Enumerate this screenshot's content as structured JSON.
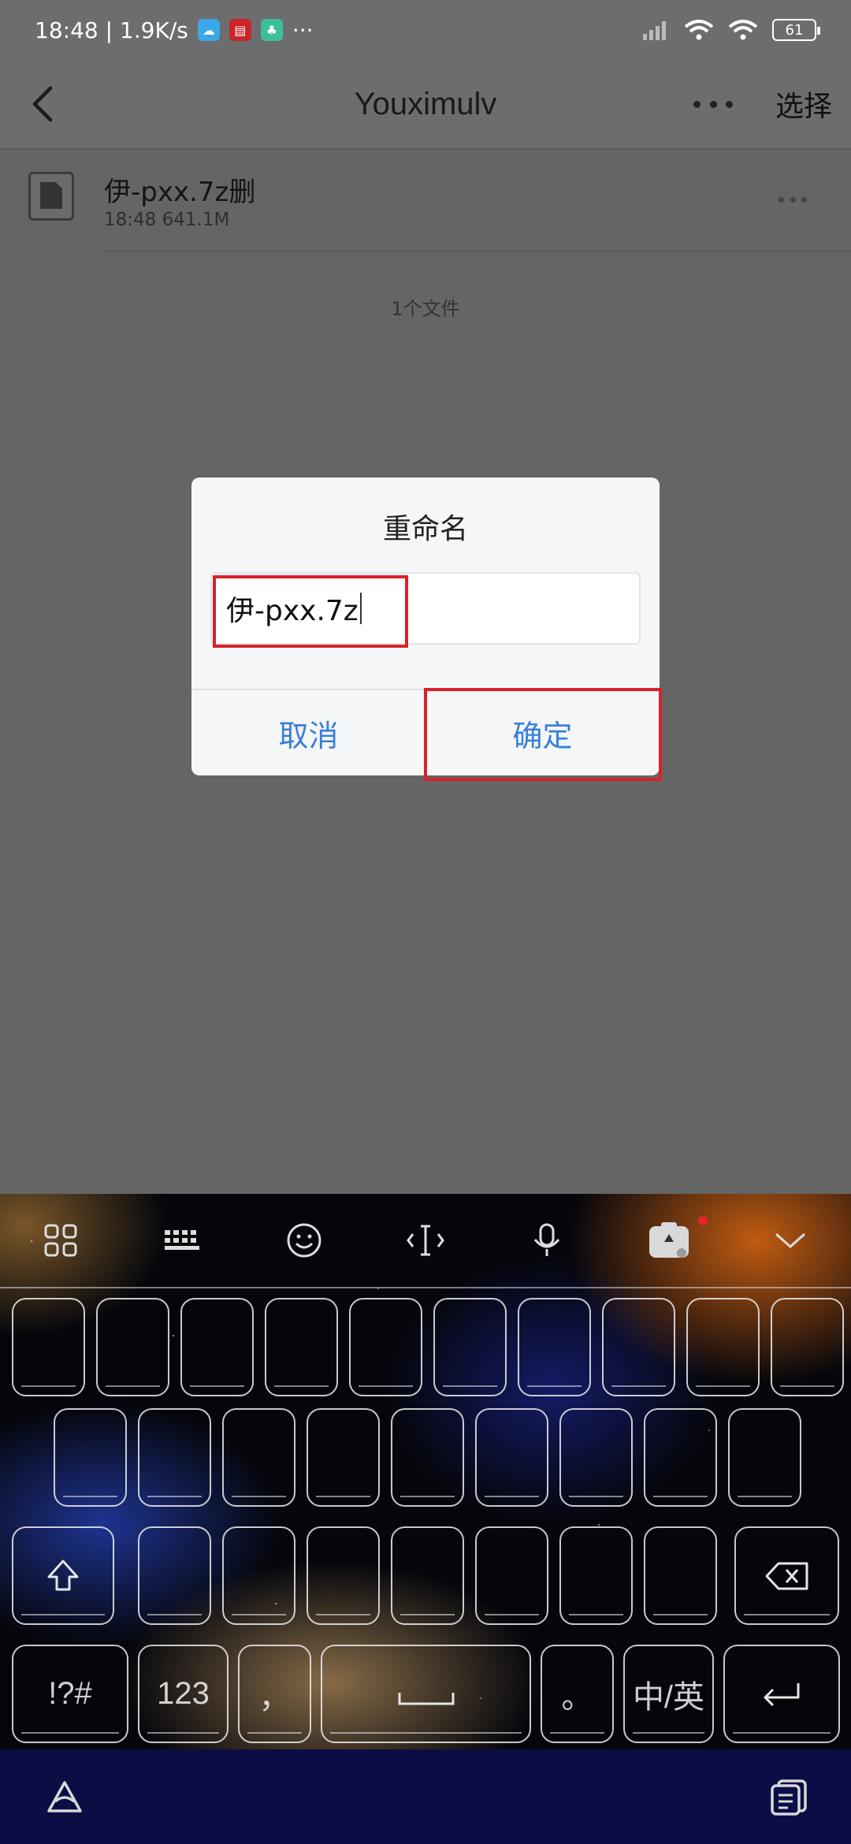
{
  "status_bar": {
    "time_speed": "18:48 | 1.9K/s",
    "more_dots": "···",
    "battery": "61"
  },
  "header": {
    "title": "Youximulv",
    "select_label": "选择"
  },
  "file": {
    "name": "伊-pxx.7z删",
    "meta": "18:48  641.1M"
  },
  "file_count": "1个文件",
  "dialog": {
    "title": "重命名",
    "input_value": "伊-pxx.7z",
    "cancel_label": "取消",
    "ok_label": "确定",
    "highlight_color": "#d8222a",
    "button_color": "#3a7fd5"
  },
  "keyboard": {
    "toolbar_icons": [
      "grid-icon",
      "keyboard-icon",
      "emoji-icon",
      "cursor-icon",
      "microphone-icon",
      "toolbox-icon",
      "collapse-icon"
    ],
    "row4_labels": {
      "symbols": "!?#",
      "numbers": "123",
      "comma": "，",
      "space": "",
      "period": "。",
      "lang": "中/英"
    }
  }
}
